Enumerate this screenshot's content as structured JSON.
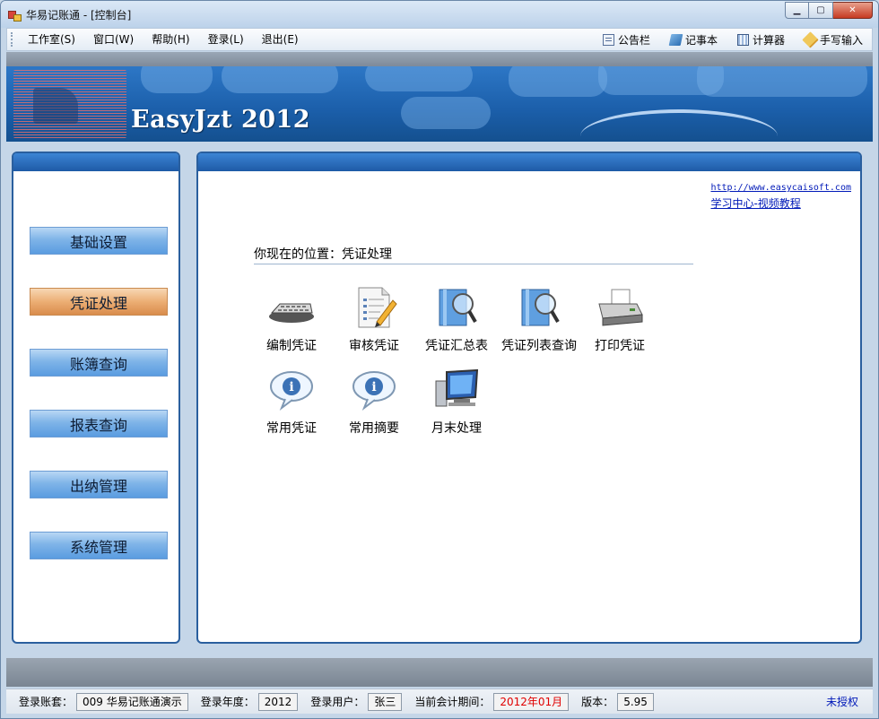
{
  "window": {
    "title": "华易记账通 - [控制台]",
    "controls": {
      "minimize": "▁",
      "maximize": "▢",
      "close": "✕"
    }
  },
  "menu": {
    "items": [
      "工作室(S)",
      "窗口(W)",
      "帮助(H)",
      "登录(L)",
      "退出(E)"
    ],
    "tools": [
      {
        "label": "公告栏",
        "icon": "bulletin-board-icon"
      },
      {
        "label": "记事本",
        "icon": "notepad-icon"
      },
      {
        "label": "计算器",
        "icon": "calculator-icon"
      },
      {
        "label": "手写输入",
        "icon": "pen-icon"
      }
    ]
  },
  "banner": {
    "brand": "EasyJzt 2012"
  },
  "sidebar": {
    "items": [
      {
        "label": "基础设置",
        "active": false
      },
      {
        "label": "凭证处理",
        "active": true
      },
      {
        "label": "账簿查询",
        "active": false
      },
      {
        "label": "报表查询",
        "active": false
      },
      {
        "label": "出纳管理",
        "active": false
      },
      {
        "label": "系统管理",
        "active": false
      }
    ]
  },
  "main": {
    "links": {
      "website": "http://www.easycaisoft.com",
      "tutorial": "学习中心-视频教程"
    },
    "location": "你现在的位置：凭证处理",
    "functions": [
      {
        "label": "编制凭证",
        "icon": "keyboard-icon"
      },
      {
        "label": "审核凭证",
        "icon": "document-pencil-icon"
      },
      {
        "label": "凭证汇总表",
        "icon": "magnifier-book-icon"
      },
      {
        "label": "凭证列表查询",
        "icon": "magnifier-book-icon"
      },
      {
        "label": "打印凭证",
        "icon": "printer-icon"
      },
      {
        "label": "常用凭证",
        "icon": "info-bubble-icon"
      },
      {
        "label": "常用摘要",
        "icon": "info-bubble-icon"
      },
      {
        "label": "月末处理",
        "icon": "computer-icon"
      }
    ]
  },
  "status": {
    "account_label": "登录账套：",
    "account_value": "009 华易记账通演示",
    "year_label": "登录年度：",
    "year_value": "2012",
    "user_label": "登录用户：",
    "user_value": "张三",
    "period_label": "当前会计期间：",
    "period_value": "2012年01月",
    "version_label": "版本：",
    "version_value": "5.95",
    "license": "未授权"
  },
  "colors": {
    "accent": "#1e5aa6",
    "active_nav": "#ecae74",
    "link": "#0019b8",
    "period_red": "#e00000"
  }
}
